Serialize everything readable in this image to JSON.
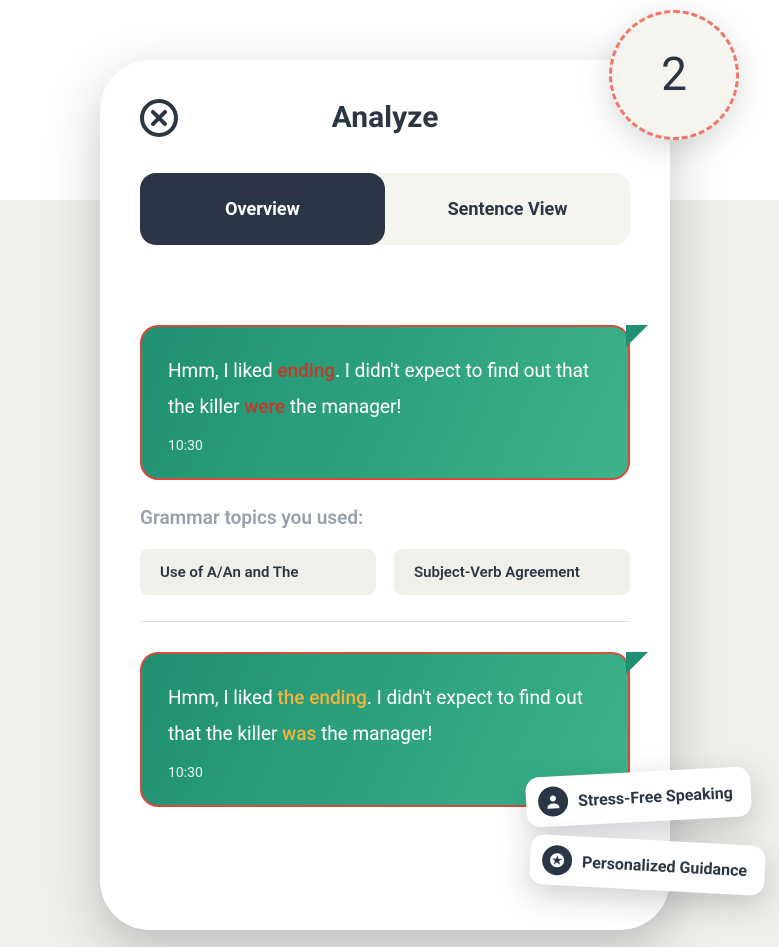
{
  "step_number": "2",
  "header": {
    "title": "Analyze"
  },
  "tabs": {
    "overview": "Overview",
    "sentence_view": "Sentence View"
  },
  "bubble1": {
    "p1": "Hmm, I liked ",
    "err1": "ending",
    "p2": ". I didn't expect to find out that the killer ",
    "err2": "were",
    "p3": " the manager!",
    "timestamp": "10:30"
  },
  "grammar_heading": "Grammar topics you used:",
  "topics": {
    "t1": "Use of A/An and The",
    "t2": "Subject-Verb Agreement"
  },
  "bubble2": {
    "p1": "Hmm, I liked ",
    "corr1": "the ending",
    "p2": ". I didn't expect to find out that the killer ",
    "corr2": "was",
    "p3": " the manager!",
    "timestamp": "10:30"
  },
  "pills": {
    "p1": "Stress-Free Speaking",
    "p2": "Personalized Guidance"
  }
}
